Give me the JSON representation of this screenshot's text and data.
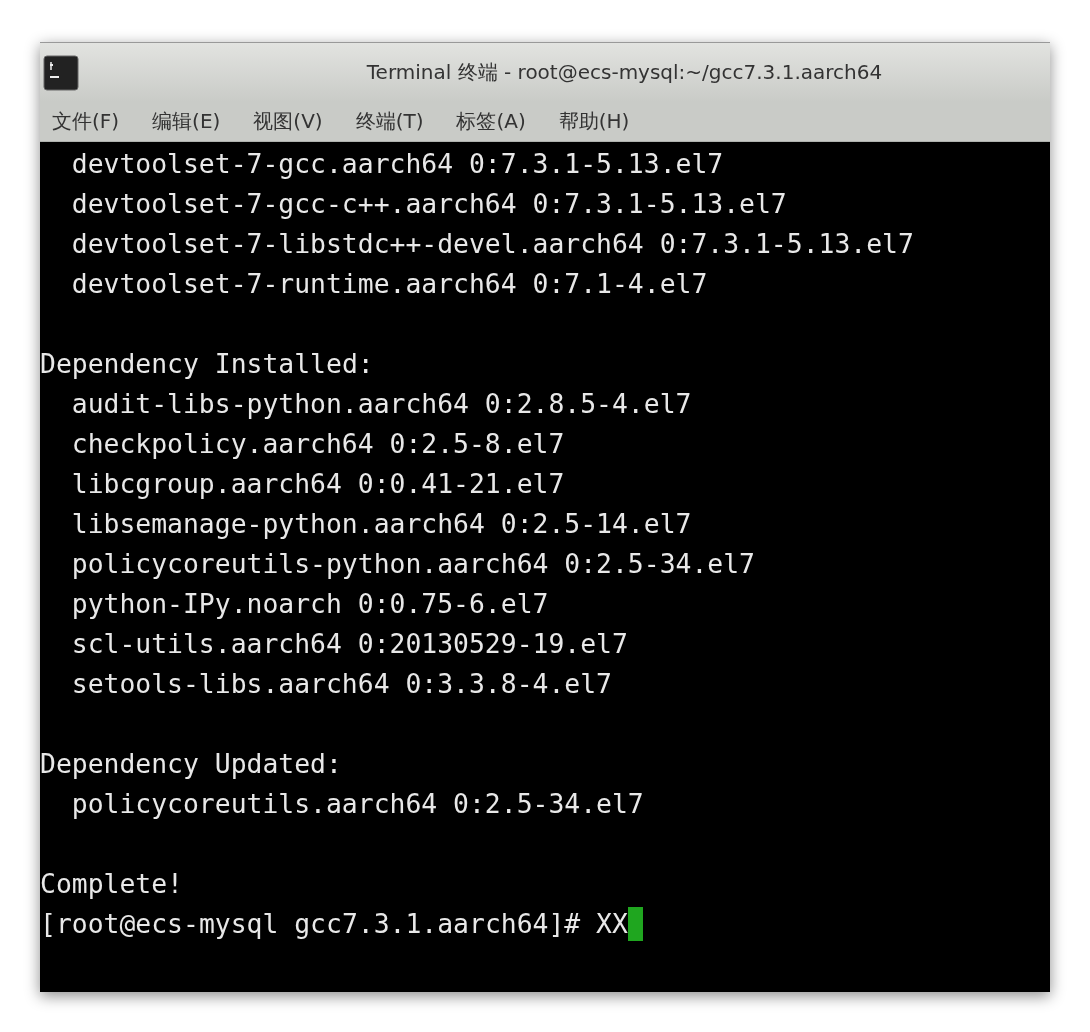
{
  "window": {
    "title": "Terminal 终端 - root@ecs-mysql:~/gcc7.3.1.aarch64"
  },
  "menu": [
    "文件(F)",
    "编辑(E)",
    "视图(V)",
    "终端(T)",
    "标签(A)",
    "帮助(H)"
  ],
  "lines": [
    {
      "kind": "item",
      "text": "devtoolset-7-gcc.aarch64 0:7.3.1-5.13.el7"
    },
    {
      "kind": "item",
      "text": "devtoolset-7-gcc-c++.aarch64 0:7.3.1-5.13.el7"
    },
    {
      "kind": "item",
      "text": "devtoolset-7-libstdc++-devel.aarch64 0:7.3.1-5.13.el7"
    },
    {
      "kind": "item",
      "text": "devtoolset-7-runtime.aarch64 0:7.1-4.el7"
    },
    {
      "kind": "blank"
    },
    {
      "kind": "heading",
      "text": "Dependency Installed:"
    },
    {
      "kind": "item",
      "text": "audit-libs-python.aarch64 0:2.8.5-4.el7"
    },
    {
      "kind": "item",
      "text": "checkpolicy.aarch64 0:2.5-8.el7"
    },
    {
      "kind": "item",
      "text": "libcgroup.aarch64 0:0.41-21.el7"
    },
    {
      "kind": "item",
      "text": "libsemanage-python.aarch64 0:2.5-14.el7"
    },
    {
      "kind": "item",
      "text": "policycoreutils-python.aarch64 0:2.5-34.el7"
    },
    {
      "kind": "item",
      "text": "python-IPy.noarch 0:0.75-6.el7"
    },
    {
      "kind": "item",
      "text": "scl-utils.aarch64 0:20130529-19.el7"
    },
    {
      "kind": "item",
      "text": "setools-libs.aarch64 0:3.3.8-4.el7"
    },
    {
      "kind": "blank"
    },
    {
      "kind": "heading",
      "text": "Dependency Updated:"
    },
    {
      "kind": "item",
      "text": "policycoreutils.aarch64 0:2.5-34.el7"
    },
    {
      "kind": "blank"
    },
    {
      "kind": "heading",
      "text": "Complete!"
    },
    {
      "kind": "prompt",
      "text": "[root@ecs-mysql gcc7.3.1.aarch64]# XX",
      "cursor": true
    }
  ]
}
